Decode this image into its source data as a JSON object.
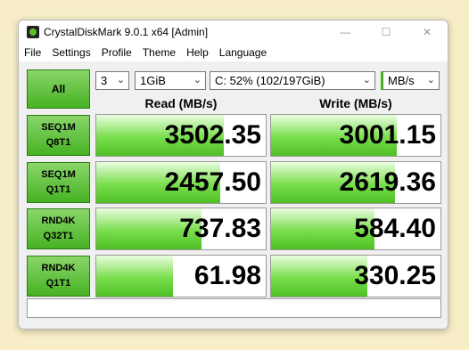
{
  "window": {
    "title": "CrystalDiskMark 9.0.1 x64 [Admin]",
    "controls": {
      "minimize": "—",
      "maximize": "☐",
      "close": "✕"
    }
  },
  "menu": [
    "File",
    "Settings",
    "Profile",
    "Theme",
    "Help",
    "Language"
  ],
  "toolbar": {
    "all_label": "All",
    "count": "3",
    "size": "1GiB",
    "drive": "C: 52% (102/197GiB)",
    "unit": "MB/s"
  },
  "headers": {
    "read": "Read (MB/s)",
    "write": "Write (MB/s)"
  },
  "tests": [
    {
      "line1": "SEQ1M",
      "line2": "Q8T1",
      "read": "3502.35",
      "write": "3001.15",
      "read_fill": 0.75,
      "write_fill": 0.74
    },
    {
      "line1": "SEQ1M",
      "line2": "Q1T1",
      "read": "2457.50",
      "write": "2619.36",
      "read_fill": 0.73,
      "write_fill": 0.73
    },
    {
      "line1": "RND4K",
      "line2": "Q32T1",
      "read": "737.83",
      "write": "584.40",
      "read_fill": 0.62,
      "write_fill": 0.61
    },
    {
      "line1": "RND4K",
      "line2": "Q1T1",
      "read": "61.98",
      "write": "330.25",
      "read_fill": 0.45,
      "write_fill": 0.57
    }
  ],
  "colors": {
    "accent_green": "#46b223",
    "bar_green": "#79de4c",
    "background": "#f7eec7"
  },
  "icons": {
    "app": "crystaldiskmark-icon",
    "dropdown": "chevron-down-icon"
  }
}
